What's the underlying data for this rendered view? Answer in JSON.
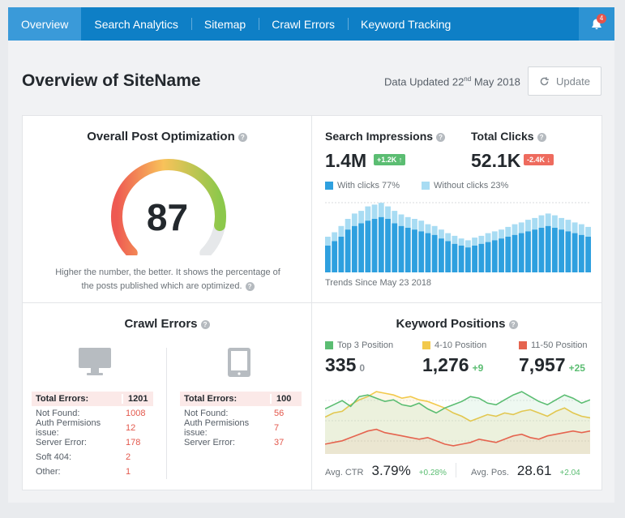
{
  "nav": {
    "tabs": [
      "Overview",
      "Search Analytics",
      "Sitemap",
      "Crawl Errors",
      "Keyword Tracking"
    ],
    "notification_count": "4"
  },
  "header": {
    "title": "Overview of SiteName",
    "updated_prefix": "Data Updated 22",
    "updated_sup": "nd",
    "updated_suffix": " May 2018",
    "update_button": "Update"
  },
  "optimization": {
    "title": "Overall Post Optimization",
    "score": "87",
    "score_fraction": 0.87,
    "description_line1": "Higher the number, the better. It shows the percentage of",
    "description_line2": "the posts published which are optimized."
  },
  "search": {
    "impressions_label": "Search Impressions",
    "impressions_value": "1.4M",
    "impressions_delta": "+1.2K ↑",
    "clicks_label": "Total Clicks",
    "clicks_value": "52.1K",
    "clicks_delta": "-2.4K ↓",
    "legend_with": "With clicks 77%",
    "legend_without": "Without clicks 23%",
    "trend_label": "Trends Since May 23 2018",
    "colors": {
      "with": "#2ea0df",
      "without": "#a8dcf3"
    },
    "bars_with": [
      30,
      35,
      40,
      48,
      52,
      55,
      58,
      60,
      62,
      60,
      55,
      52,
      50,
      48,
      46,
      44,
      42,
      38,
      35,
      32,
      30,
      28,
      30,
      32,
      34,
      36,
      38,
      40,
      42,
      44,
      46,
      48,
      50,
      52,
      50,
      48,
      46,
      44,
      42,
      40
    ],
    "bars_without": [
      10,
      10,
      12,
      12,
      14,
      14,
      16,
      16,
      16,
      14,
      14,
      13,
      12,
      12,
      12,
      10,
      10,
      10,
      9,
      9,
      8,
      8,
      9,
      9,
      10,
      10,
      10,
      11,
      12,
      12,
      13,
      13,
      14,
      14,
      14,
      13,
      13,
      12,
      12,
      11
    ]
  },
  "crawl": {
    "title": "Crawl Errors",
    "desktop": {
      "total_label": "Total Errors:",
      "total_value": "1201",
      "rows": [
        {
          "label": "Not Found:",
          "value": "1008"
        },
        {
          "label": "Auth Permisions issue:",
          "value": "12"
        },
        {
          "label": "Server Error:",
          "value": "178"
        },
        {
          "label": "Soft 404:",
          "value": "2"
        },
        {
          "label": "Other:",
          "value": "1"
        }
      ]
    },
    "mobile": {
      "total_label": "Total Errors:",
      "total_value": "100",
      "rows": [
        {
          "label": "Not Found:",
          "value": "56"
        },
        {
          "label": "Auth Permisions issue:",
          "value": "7"
        },
        {
          "label": "Server Error:",
          "value": "37"
        }
      ]
    }
  },
  "keywords": {
    "title": "Keyword Positions",
    "top3_label": "Top 3 Position",
    "top3_value": "335",
    "top3_delta": "0",
    "mid_label": "4-10 Position",
    "mid_value": "1,276",
    "mid_delta": "+9",
    "low_label": "11-50 Position",
    "low_value": "7,957",
    "low_delta": "+25",
    "ctr_label": "Avg. CTR",
    "ctr_value": "3.79%",
    "ctr_delta": "+0.28%",
    "pos_label": "Avg. Pos.",
    "pos_value": "28.61",
    "pos_delta": "+2.04",
    "colors": {
      "green": "#5bbd72",
      "yellow": "#f2c94c",
      "red": "#e5644f"
    },
    "series_green": [
      55,
      60,
      65,
      58,
      70,
      72,
      68,
      64,
      66,
      60,
      58,
      62,
      55,
      50,
      56,
      60,
      64,
      70,
      68,
      62,
      60,
      66,
      72,
      76,
      70,
      64,
      60,
      66,
      72,
      68,
      62,
      66
    ],
    "series_yellow": [
      45,
      50,
      52,
      60,
      66,
      70,
      76,
      74,
      72,
      68,
      70,
      66,
      64,
      60,
      56,
      50,
      46,
      40,
      44,
      48,
      46,
      50,
      48,
      52,
      54,
      50,
      46,
      52,
      56,
      50,
      46,
      44
    ],
    "series_red": [
      12,
      14,
      16,
      20,
      24,
      28,
      30,
      26,
      24,
      22,
      20,
      18,
      20,
      16,
      12,
      10,
      12,
      14,
      18,
      16,
      14,
      18,
      22,
      24,
      20,
      18,
      22,
      24,
      26,
      28,
      26,
      28
    ]
  }
}
